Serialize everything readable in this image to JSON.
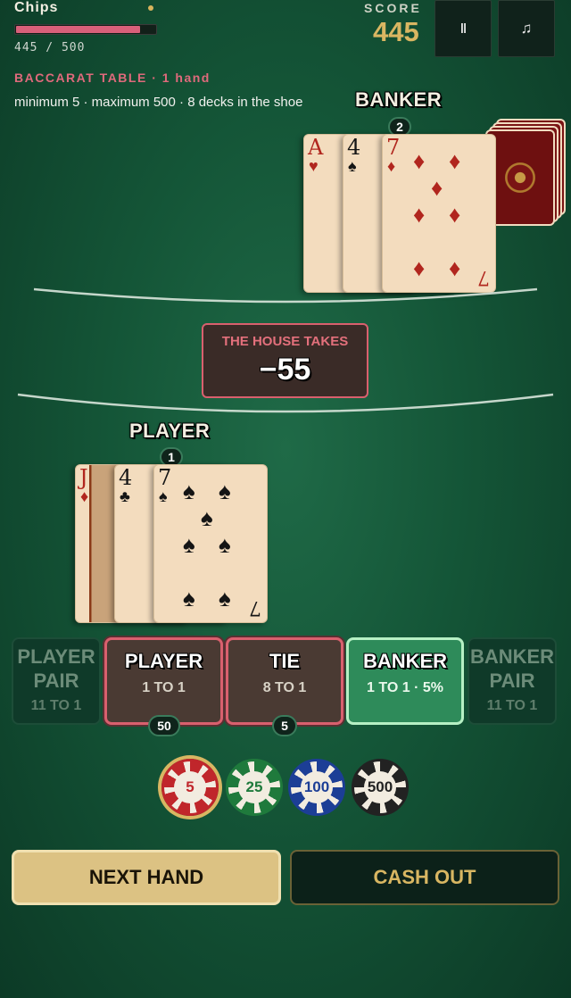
{
  "header": {
    "chips_title": "Chips",
    "chips_fraction": 0.89,
    "chips_count": "445 / 500",
    "score_label": "SCORE",
    "score_value": "445",
    "pause_icon": "pause-icon",
    "pause_label": "ll",
    "music_icon": "music-icon",
    "music_label": "♫"
  },
  "table": {
    "title": "BACCARAT TABLE · 1 hand",
    "limits": "minimum 5 · maximum 500 · 8 decks in the shoe"
  },
  "banker": {
    "label": "BANKER",
    "total": "2",
    "cards": [
      {
        "rank": "A",
        "suit": "♥",
        "color": "red"
      },
      {
        "rank": "4",
        "suit": "♠",
        "color": "black"
      },
      {
        "rank": "7",
        "suit": "♦",
        "color": "red"
      }
    ]
  },
  "result": {
    "label": "THE HOUSE TAKES",
    "value": "−55"
  },
  "player": {
    "label": "PLAYER",
    "total": "1",
    "cards": [
      {
        "rank": "J",
        "suit": "♦",
        "color": "red"
      },
      {
        "rank": "4",
        "suit": "♣",
        "color": "black"
      },
      {
        "rank": "7",
        "suit": "♠",
        "color": "black"
      }
    ]
  },
  "bets": [
    {
      "name": "PLAYER PAIR",
      "odds": "11 TO 1",
      "state": "disabled"
    },
    {
      "name": "PLAYER",
      "odds": "1 TO 1",
      "state": "lost",
      "stake": "50"
    },
    {
      "name": "TIE",
      "odds": "8 TO 1",
      "state": "lost",
      "stake": "5"
    },
    {
      "name": "BANKER",
      "odds": "1 TO 1 · 5%",
      "state": "won"
    },
    {
      "name": "BANKER PAIR",
      "odds": "11 TO 1",
      "state": "disabled"
    }
  ],
  "chips": [
    {
      "value": "5",
      "color": "#c0262b",
      "selected": true
    },
    {
      "value": "25",
      "color": "#1f7a3c",
      "selected": false
    },
    {
      "value": "100",
      "color": "#1c3e96",
      "selected": false
    },
    {
      "value": "500",
      "color": "#222222",
      "selected": false
    }
  ],
  "actions": {
    "next_hand": "NEXT HAND",
    "cash_out": "CASH OUT"
  },
  "colors": {
    "felt": "#145537",
    "gold": "#d9b662",
    "loss": "#d9606e",
    "win": "#2e8b5a"
  }
}
